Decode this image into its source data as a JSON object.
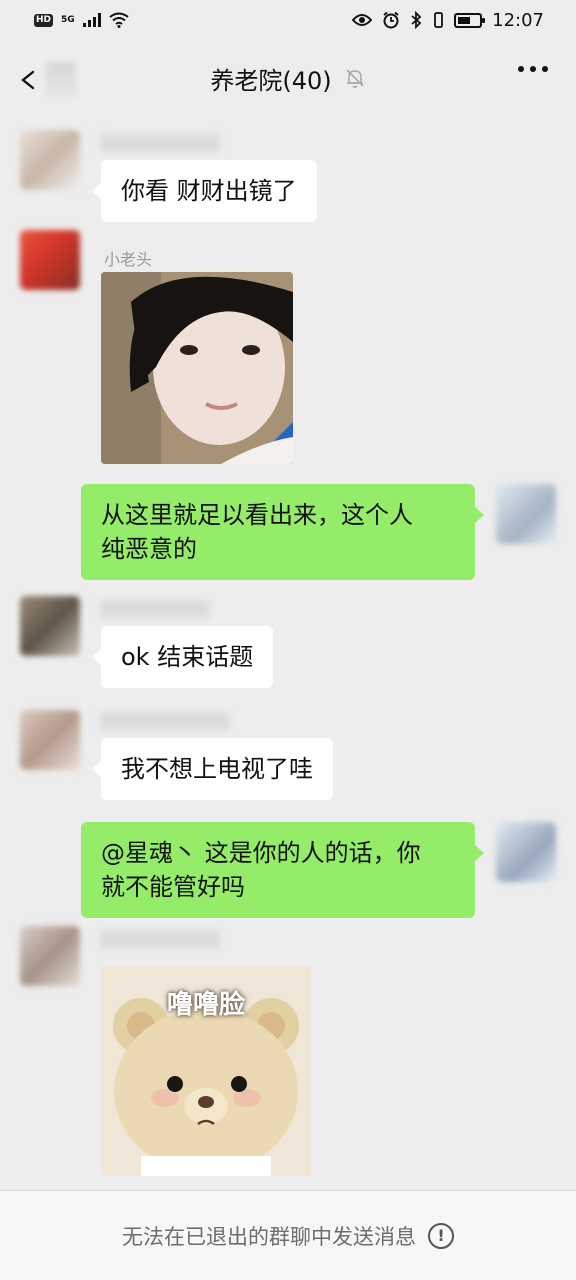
{
  "status_bar": {
    "hd": "HD",
    "network": "5G",
    "time": "12:07"
  },
  "header": {
    "title": "养老院(40)"
  },
  "messages": [
    {
      "side": "left",
      "text": "你看 财财出镜了"
    },
    {
      "side": "left",
      "sender": "小老头",
      "type": "image"
    },
    {
      "side": "right",
      "text_line1": "从这里就足以看出来，这个人",
      "text_line2": "纯恶意的"
    },
    {
      "side": "left",
      "text": "ok 结束话题"
    },
    {
      "side": "left",
      "text": "我不想上电视了哇"
    },
    {
      "side": "right",
      "text_line1": "@星魂丶  这是你的人的话，你",
      "text_line2": "就不能管好吗"
    },
    {
      "side": "left",
      "type": "sticker",
      "caption": "噜噜脸"
    }
  ],
  "footer": {
    "notice": "无法在已退出的群聊中发送消息",
    "icon": "!"
  }
}
